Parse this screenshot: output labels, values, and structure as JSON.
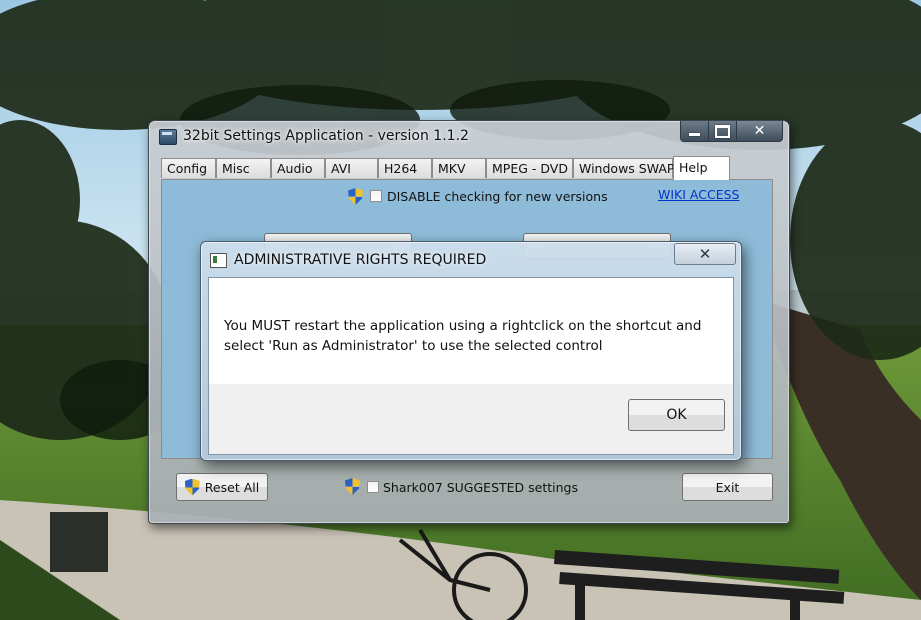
{
  "app_window": {
    "title": "32bit Settings Application - version 1.1.2",
    "tabs": [
      {
        "label": "Config"
      },
      {
        "label": "Misc"
      },
      {
        "label": "Audio"
      },
      {
        "label": "AVI"
      },
      {
        "label": "H264"
      },
      {
        "label": "MKV"
      },
      {
        "label": "MPEG - DVD"
      },
      {
        "label": "Windows SWAP"
      },
      {
        "label": "Help",
        "active": true
      }
    ],
    "help_panel": {
      "disable_check_label": "DISABLE checking for new versions",
      "disable_check_checked": false,
      "wiki_link": "WIKI   ACCESS"
    },
    "footer": {
      "reset_label": "Reset All",
      "suggested_label": "Shark007 SUGGESTED settings",
      "suggested_checked": false,
      "exit_label": "Exit"
    }
  },
  "dialog": {
    "title": "ADMINISTRATIVE RIGHTS REQUIRED",
    "close_glyph": "✕",
    "message_line1": "You MUST restart the application using a rightclick on the shortcut and",
    "message_line2": "select 'Run as Administrator' to use the selected control",
    "ok_label": "OK"
  },
  "colors": {
    "panel_bg": "#8ebcd8",
    "link": "#0033cc"
  }
}
